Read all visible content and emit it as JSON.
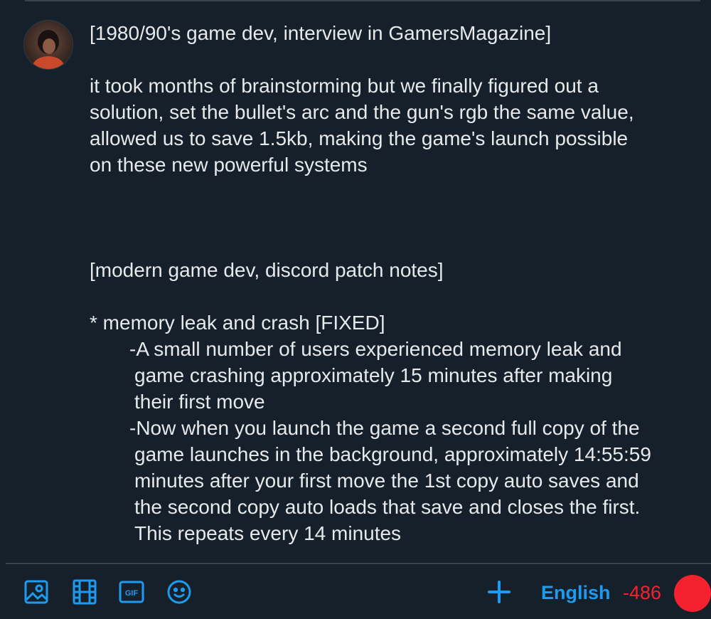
{
  "colors": {
    "background": "#15202b",
    "accent": "#1d9bf0",
    "danger": "#f4212e",
    "text": "#e7e9ea"
  },
  "avatar": {
    "icon": "user-avatar"
  },
  "composer": {
    "lines": [
      "[1980/90's game dev, interview in GamersMagazine]",
      "",
      "it took months of brainstorming but we finally figured out a",
      "solution, set the bullet's arc and the gun's rgb the same value,",
      "allowed us to save 1.5kb, making the game's launch possible",
      "on these new powerful systems",
      "",
      "",
      "",
      "[modern game dev, discord patch notes]",
      "",
      "* memory leak and crash [FIXED]",
      "-A small number of users experienced memory leak and",
      "game crashing approximately 15 minutes after making",
      "their first move",
      "-Now when you launch the game a second full copy of the",
      "game launches in the background, approximately 14:55:59",
      "minutes after your first move the 1st copy auto saves and",
      "the second copy auto loads that save and closes the first.",
      "This repeats every 14 minutes"
    ]
  },
  "toolbar": {
    "icons": [
      "image-icon",
      "video-icon",
      "gif-icon",
      "emoji-icon",
      "plus-icon"
    ],
    "language": "English",
    "char_count": "-486",
    "progress_ring_fraction": 1.0
  }
}
